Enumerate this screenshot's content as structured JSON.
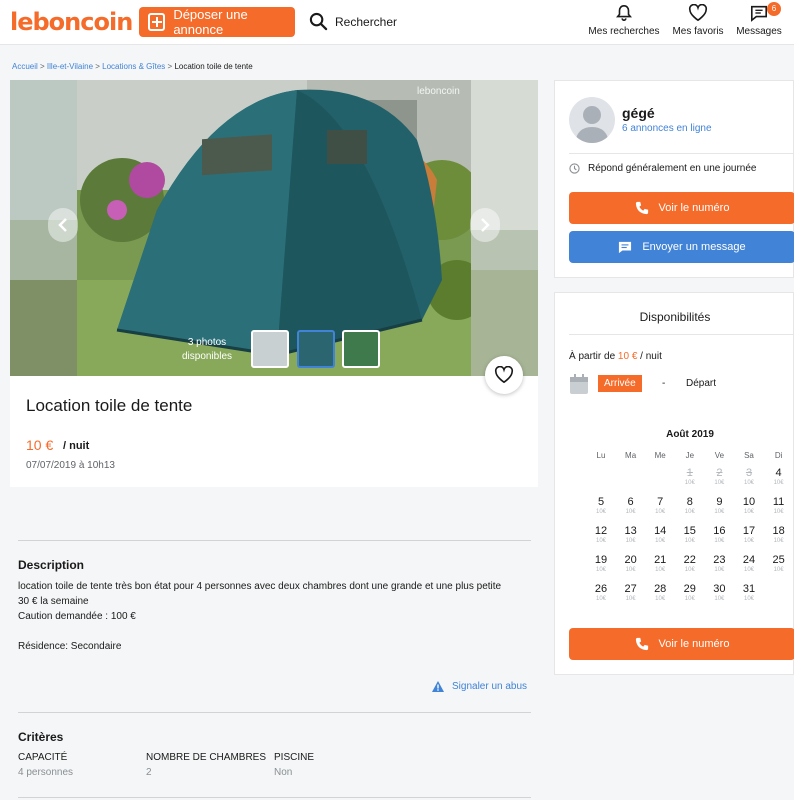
{
  "header": {
    "logo": "leboncoin",
    "post_label": "Déposer une annonce",
    "search_label": "Rechercher",
    "nav": [
      {
        "label": "Mes recherches",
        "icon": "bell-icon"
      },
      {
        "label": "Mes favoris",
        "icon": "heart-icon"
      },
      {
        "label": "Messages",
        "icon": "message-icon",
        "badge": "6"
      }
    ]
  },
  "breadcrumb": [
    "Accueil",
    "Ille-et-Vilaine",
    "Locations & Gîtes",
    "Location toile de tente"
  ],
  "gallery": {
    "watermark": "leboncoin",
    "photo_count_line1": "3 photos",
    "photo_count_line2": "disponibles"
  },
  "ad": {
    "title": "Location toile de tente",
    "price": "10 €",
    "per_night": "/ nuit",
    "date": "07/07/2019 à 10h13"
  },
  "description": {
    "title": "Description",
    "line1": "location toile de tente très bon état pour 4 personnes avec deux chambres dont une grande et une plus petite",
    "line2": "30 € la semaine",
    "line3": "Caution demandée : 100 €",
    "line4": "Résidence: Secondaire",
    "report": "Signaler un abus"
  },
  "criteria": {
    "title": "Critères",
    "items": [
      {
        "label": "CAPACITÉ",
        "value": "4 personnes"
      },
      {
        "label": "NOMBRE DE CHAMBRES",
        "value": "2"
      },
      {
        "label": "PISCINE",
        "value": "Non"
      }
    ]
  },
  "seller": {
    "name": "gégé",
    "ads": "6 annonces en ligne",
    "response": "Répond généralement en une journée",
    "phone_btn": "Voir le numéro",
    "message_btn": "Envoyer un message"
  },
  "availability": {
    "title": "Disponibilités",
    "from_prefix": "À partir de",
    "price": "10 €",
    "per_night": "/ nuit",
    "arrival": "Arrivée",
    "dash": "-",
    "departure": "Départ",
    "month": "Août 2019",
    "weekdays": [
      "Lu",
      "Ma",
      "Me",
      "Je",
      "Ve",
      "Sa",
      "Di"
    ],
    "day_price": "10€",
    "days": [
      {
        "n": "1",
        "past": true
      },
      {
        "n": "2",
        "past": true
      },
      {
        "n": "3",
        "past": true
      },
      {
        "n": "4",
        "past": false
      },
      {
        "n": "5"
      },
      {
        "n": "6"
      },
      {
        "n": "7"
      },
      {
        "n": "8"
      },
      {
        "n": "9"
      },
      {
        "n": "10"
      },
      {
        "n": "11"
      },
      {
        "n": "12"
      },
      {
        "n": "13"
      },
      {
        "n": "14"
      },
      {
        "n": "15"
      },
      {
        "n": "16"
      },
      {
        "n": "17"
      },
      {
        "n": "18"
      },
      {
        "n": "19"
      },
      {
        "n": "20"
      },
      {
        "n": "21"
      },
      {
        "n": "22"
      },
      {
        "n": "23"
      },
      {
        "n": "24"
      },
      {
        "n": "25"
      },
      {
        "n": "26"
      },
      {
        "n": "27"
      },
      {
        "n": "28"
      },
      {
        "n": "29"
      },
      {
        "n": "30"
      },
      {
        "n": "31"
      }
    ],
    "phone_btn": "Voir le numéro"
  },
  "colors": {
    "brand": "#f56b2a",
    "link": "#4183d7"
  }
}
